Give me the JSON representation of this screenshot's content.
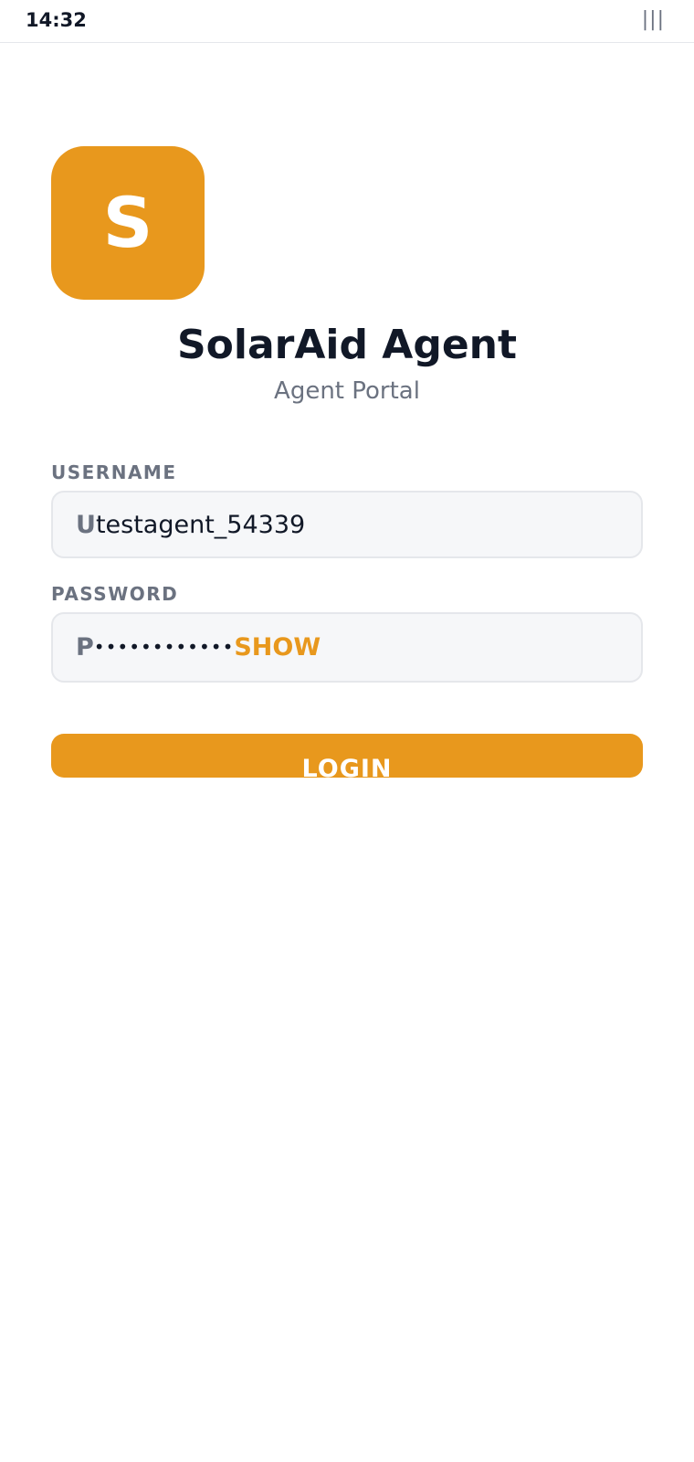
{
  "status_bar": {
    "time": "14:32",
    "menu_glyph": "|||"
  },
  "app": {
    "logo_letter": "S",
    "title": "SolarAid Agent",
    "subtitle": "Agent Portal",
    "accent_color": "#e8981d"
  },
  "form": {
    "username": {
      "label": "USERNAME",
      "prefix": "U",
      "value": "testagent_54339"
    },
    "password": {
      "label": "PASSWORD",
      "prefix": "P",
      "masked_value": "••••••••••••",
      "toggle_label": "SHOW"
    },
    "login_label": "LOGIN"
  },
  "icons": {
    "menu": "menu-icon"
  }
}
